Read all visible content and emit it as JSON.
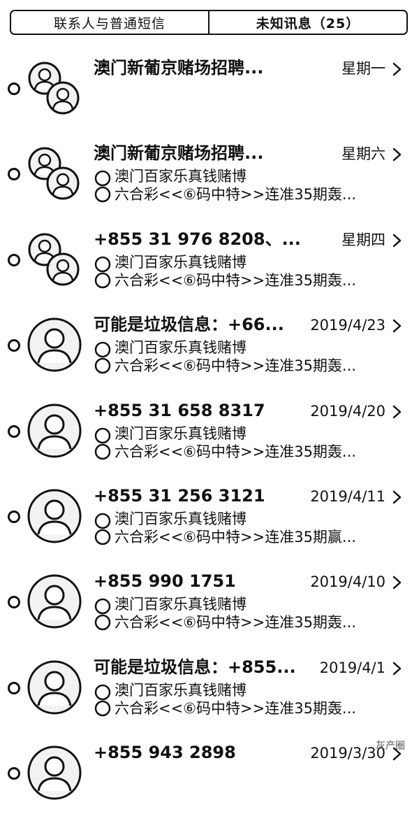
{
  "segmented": {
    "left": "联系人与普通短信",
    "right": "未知讯息（25）"
  },
  "threads": [
    {
      "title": "澳门新葡京赌场招聘...",
      "date": "星期一",
      "sender": "",
      "preview": "",
      "group": true
    },
    {
      "title": "澳门新葡京赌场招聘...",
      "date": "星期六",
      "sender": "澳门百家乐真钱赌博",
      "preview": "六合彩<<⑥码中特>>连准35期轰...",
      "group": true
    },
    {
      "title": "+855 31 976 8208、...",
      "date": "星期四",
      "sender": "澳门百家乐真钱赌博",
      "preview": "六合彩<<⑥码中特>>连准35期轰...",
      "group": true
    },
    {
      "title": "可能是垃圾信息：+66...",
      "date": "2019/4/23",
      "sender": "澳门百家乐真钱赌博",
      "preview": "六合彩<<⑥码中特>>连准35期轰...",
      "group": false
    },
    {
      "title": "+855 31 658 8317",
      "date": "2019/4/20",
      "sender": "澳门百家乐真钱赌博",
      "preview": "六合彩<<⑥码中特>>连准35期轰...",
      "group": false
    },
    {
      "title": "+855 31 256 3121",
      "date": "2019/4/11",
      "sender": "澳门百家乐真钱赌博",
      "preview": "六合彩<<⑥码中特>>连准35期赢...",
      "group": false
    },
    {
      "title": "+855 990 1751",
      "date": "2019/4/10",
      "sender": "澳门百家乐真钱赌博",
      "preview": "六合彩<<⑥码中特>>连准35期轰...",
      "group": false
    },
    {
      "title": "可能是垃圾信息：+855...",
      "date": "2019/4/1",
      "sender": "澳门百家乐真钱赌博",
      "preview": "六合彩<<⑥码中特>>连准35期轰...",
      "group": false
    },
    {
      "title": "+855 943 2898",
      "date": "2019/3/30",
      "sender": "",
      "preview": "",
      "group": false
    }
  ],
  "icons": {
    "unread": "unread-dot-icon",
    "avatar": "person-avatar-icon",
    "group_avatar": "group-avatar-icon",
    "chevron": "chevron-right-icon"
  },
  "watermark": "灰产圈"
}
